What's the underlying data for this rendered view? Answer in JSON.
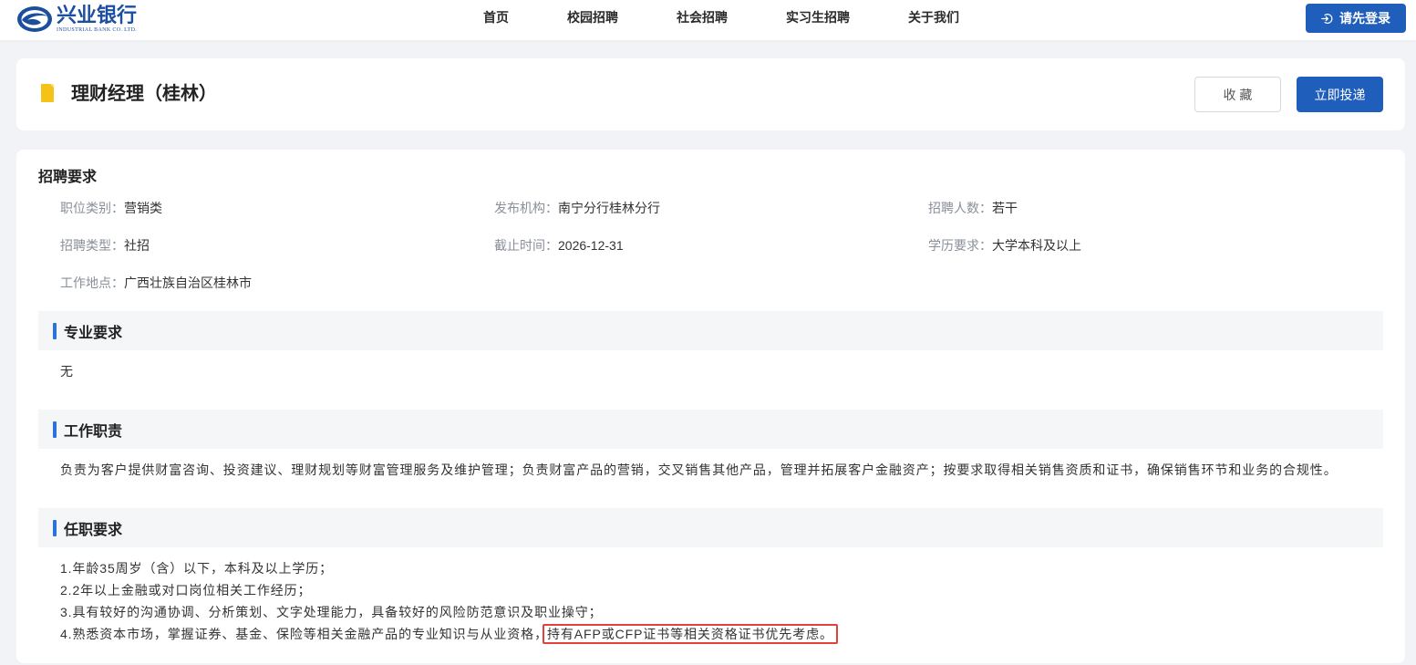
{
  "colors": {
    "primary": "#1f5ebb",
    "brand": "#1b4e9e",
    "page_bg": "#f2f3f6",
    "section_bg": "#f5f6f8",
    "accent": "#2c72db",
    "bookmark": "#f5c218",
    "highlight": "#e5403b",
    "label": "#8a8f99",
    "text": "#333333"
  },
  "header": {
    "logo": {
      "icon": "industrial-bank-logo-icon",
      "name_cn": "兴业银行",
      "name_en": "INDUSTRIAL BANK CO. LTD."
    },
    "nav": [
      {
        "label": "首页"
      },
      {
        "label": "校园招聘"
      },
      {
        "label": "社会招聘"
      },
      {
        "label": "实习生招聘"
      },
      {
        "label": "关于我们"
      }
    ],
    "login": {
      "icon": "login-icon",
      "label": "请先登录"
    }
  },
  "job": {
    "icon": "bookmark-icon",
    "title": "理财经理（桂林）",
    "favorite_label": "收 藏",
    "apply_label": "立即投递"
  },
  "requirements": {
    "heading": "招聘要求",
    "fields": [
      {
        "label": "职位类别：",
        "value": "营销类"
      },
      {
        "label": "发布机构：",
        "value": "南宁分行桂林分行"
      },
      {
        "label": "招聘人数：",
        "value": "若干"
      },
      {
        "label": "招聘类型：",
        "value": "社招"
      },
      {
        "label": "截止时间：",
        "value": "2026-12-31"
      },
      {
        "label": "学历要求：",
        "value": "大学本科及以上"
      },
      {
        "label": "工作地点：",
        "value": "广西壮族自治区桂林市"
      }
    ]
  },
  "sections": [
    {
      "title": "专业要求",
      "lines": [
        "无"
      ]
    },
    {
      "title": "工作职责",
      "lines": [
        "负责为客户提供财富咨询、投资建议、理财规划等财富管理服务及维护管理；负责财富产品的营销，交叉销售其他产品，管理并拓展客户金融资产；按要求取得相关销售资质和证书，确保销售环节和业务的合规性。"
      ]
    },
    {
      "title": "任职要求",
      "lines": [
        "1.年龄35周岁（含）以下，本科及以上学历；",
        "2.2年以上金融或对口岗位相关工作经历；",
        "3.具有较好的沟通协调、分析策划、文字处理能力，具备较好的风险防范意识及职业操守；",
        "4.熟悉资本市场，掌握证券、基金、保险等相关金融产品的专业知识与从业资格，"
      ],
      "highlighted_text": "持有AFP或CFP证书等相关资格证书优先考虑。"
    }
  ]
}
